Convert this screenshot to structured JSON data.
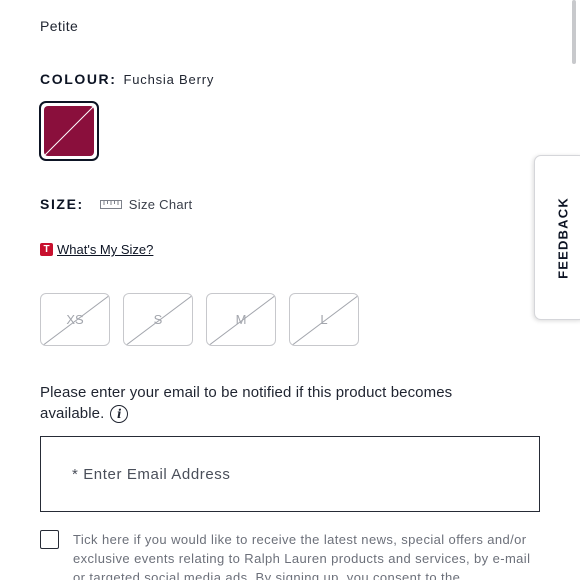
{
  "product": {
    "fit": "Petite",
    "colour_heading": "COLOUR:",
    "colour_name": "Fuchsia Berry",
    "swatch_color": "#8a0f3c",
    "size_heading": "SIZE:",
    "size_chart_label": "Size Chart",
    "whats_my_size_badge": "T",
    "whats_my_size_label": "What's My Size?",
    "sizes": [
      {
        "label": "XS",
        "available": false
      },
      {
        "label": "S",
        "available": false
      },
      {
        "label": "M",
        "available": false
      },
      {
        "label": "L",
        "available": false
      }
    ]
  },
  "notify": {
    "message": "Please enter your email to be notified if this product becomes available.",
    "email_placeholder": "* Enter Email Address",
    "consent_text": "Tick here if you would like to receive the latest news, special offers and/or exclusive events relating to Ralph Lauren products and services, by e-mail or targeted social media ads. By signing up, you consent to the"
  },
  "feedback_tab": {
    "label": "FEEDBACK"
  },
  "icons": {
    "ruler": "ruler-icon",
    "info": "info-icon",
    "badge": "t-badge-icon"
  }
}
